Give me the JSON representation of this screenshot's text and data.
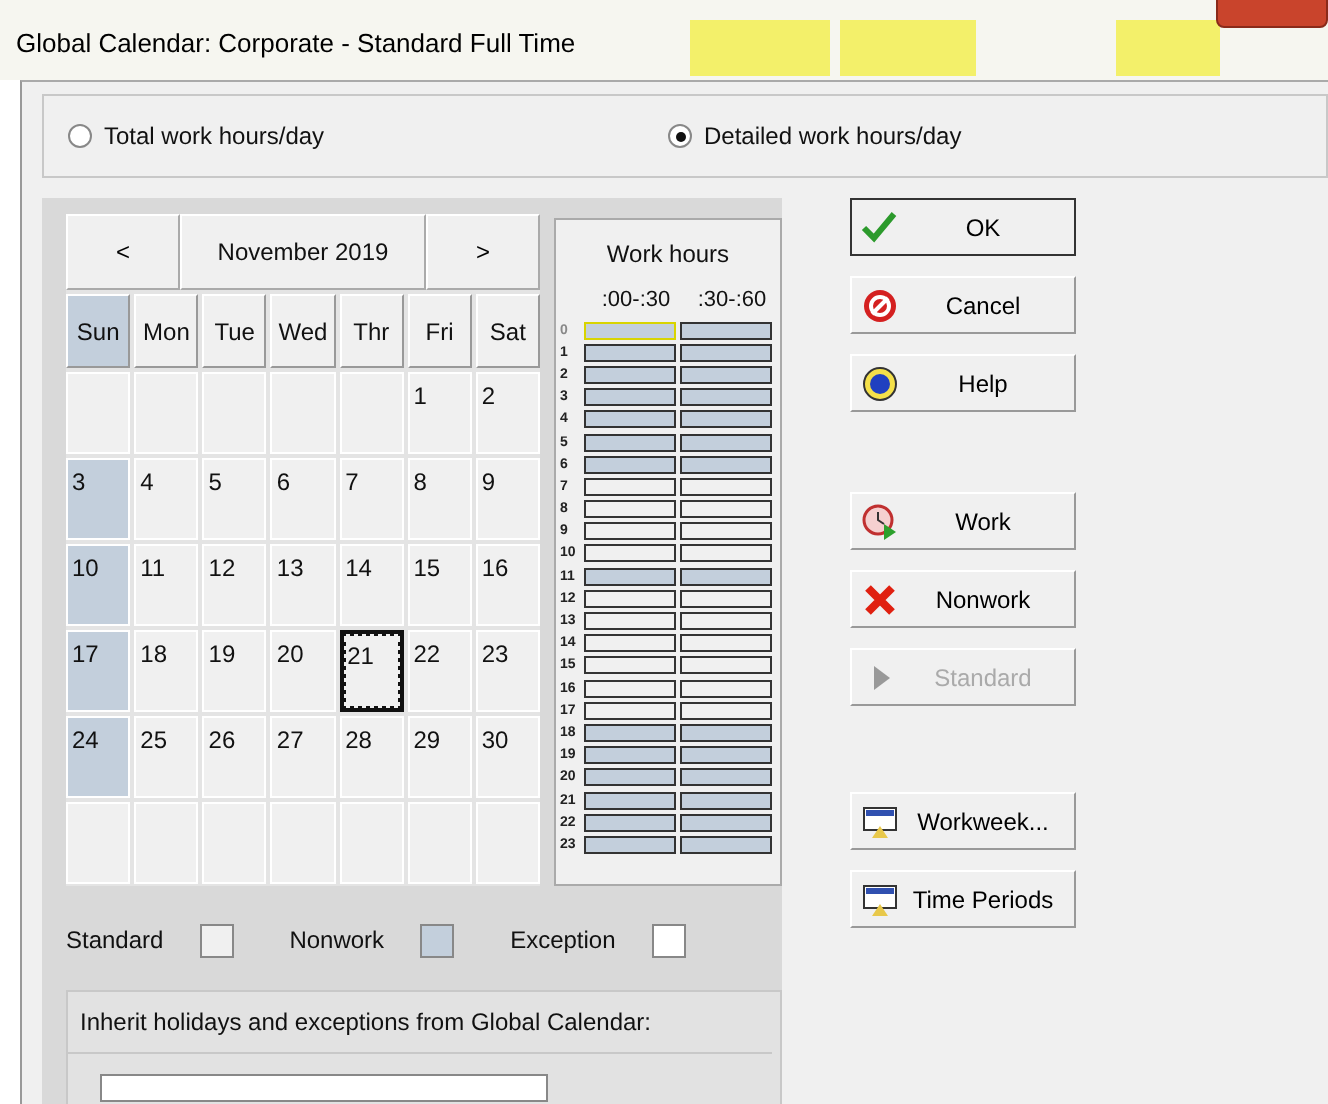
{
  "window": {
    "title": "Global Calendar: Corporate - Standard Full Time"
  },
  "mode_options": [
    {
      "label": "Total work hours/day",
      "selected": false
    },
    {
      "label": "Detailed work hours/day",
      "selected": true
    }
  ],
  "calendar": {
    "prev": "<",
    "month": "November 2019",
    "next": ">",
    "weekdays": [
      {
        "label": "Sun",
        "nonwork": true
      },
      {
        "label": "Mon",
        "nonwork": false
      },
      {
        "label": "Tue",
        "nonwork": false
      },
      {
        "label": "Wed",
        "nonwork": false
      },
      {
        "label": "Thr",
        "nonwork": false
      },
      {
        "label": "Fri",
        "nonwork": false
      },
      {
        "label": "Sat",
        "nonwork": false
      }
    ],
    "weeks": [
      [
        {
          "nonwork": false
        },
        {
          "nonwork": false
        },
        {
          "nonwork": false
        },
        {
          "nonwork": false
        },
        {
          "nonwork": false
        },
        {
          "day": "1",
          "nonwork": false,
          "selected": false
        },
        {
          "day": "2",
          "nonwork": false,
          "selected": false
        }
      ],
      [
        {
          "day": "3",
          "nonwork": true,
          "selected": false
        },
        {
          "day": "4",
          "nonwork": false,
          "selected": false
        },
        {
          "day": "5",
          "nonwork": false,
          "selected": false
        },
        {
          "day": "6",
          "nonwork": false,
          "selected": false
        },
        {
          "day": "7",
          "nonwork": false,
          "selected": false
        },
        {
          "day": "8",
          "nonwork": false,
          "selected": false
        },
        {
          "day": "9",
          "nonwork": false,
          "selected": false
        }
      ],
      [
        {
          "day": "10",
          "nonwork": true,
          "selected": false
        },
        {
          "day": "11",
          "nonwork": false,
          "selected": false
        },
        {
          "day": "12",
          "nonwork": false,
          "selected": false
        },
        {
          "day": "13",
          "nonwork": false,
          "selected": false
        },
        {
          "day": "14",
          "nonwork": false,
          "selected": false
        },
        {
          "day": "15",
          "nonwork": false,
          "selected": false
        },
        {
          "day": "16",
          "nonwork": false,
          "selected": false
        }
      ],
      [
        {
          "day": "17",
          "nonwork": true,
          "selected": false
        },
        {
          "day": "18",
          "nonwork": false,
          "selected": false
        },
        {
          "day": "19",
          "nonwork": false,
          "selected": false
        },
        {
          "day": "20",
          "nonwork": false,
          "selected": false
        },
        {
          "day": "21",
          "nonwork": false,
          "selected": true
        },
        {
          "day": "22",
          "nonwork": false,
          "selected": false
        },
        {
          "day": "23",
          "nonwork": false,
          "selected": false
        }
      ],
      [
        {
          "day": "24",
          "nonwork": true,
          "selected": false
        },
        {
          "day": "25",
          "nonwork": false,
          "selected": false
        },
        {
          "day": "26",
          "nonwork": false,
          "selected": false
        },
        {
          "day": "27",
          "nonwork": false,
          "selected": false
        },
        {
          "day": "28",
          "nonwork": false,
          "selected": false
        },
        {
          "day": "29",
          "nonwork": false,
          "selected": false
        },
        {
          "day": "30",
          "nonwork": false,
          "selected": false
        }
      ],
      [
        {
          "nonwork": false
        },
        {
          "nonwork": false
        },
        {
          "nonwork": false
        },
        {
          "nonwork": false
        },
        {
          "nonwork": false
        },
        {
          "nonwork": false
        },
        {
          "nonwork": false
        }
      ]
    ]
  },
  "work_hours": {
    "title": "Work hours",
    "columns": [
      ":00-:30",
      ":30-:60"
    ],
    "hours": [
      {
        "hour": "0",
        "slots": [
          {
            "nonwork": true,
            "selected": true
          },
          {
            "nonwork": true,
            "selected": false
          }
        ]
      },
      {
        "hour": "1",
        "slots": [
          {
            "nonwork": true,
            "selected": false
          },
          {
            "nonwork": true,
            "selected": false
          }
        ]
      },
      {
        "hour": "2",
        "slots": [
          {
            "nonwork": true,
            "selected": false
          },
          {
            "nonwork": true,
            "selected": false
          }
        ]
      },
      {
        "hour": "3",
        "slots": [
          {
            "nonwork": true,
            "selected": false
          },
          {
            "nonwork": true,
            "selected": false
          }
        ]
      },
      {
        "hour": "4",
        "slots": [
          {
            "nonwork": true,
            "selected": false
          },
          {
            "nonwork": true,
            "selected": false
          }
        ]
      },
      {
        "hour": "5",
        "slots": [
          {
            "nonwork": true,
            "selected": false
          },
          {
            "nonwork": true,
            "selected": false
          }
        ]
      },
      {
        "hour": "6",
        "slots": [
          {
            "nonwork": true,
            "selected": false
          },
          {
            "nonwork": true,
            "selected": false
          }
        ]
      },
      {
        "hour": "7",
        "slots": [
          {
            "nonwork": false,
            "selected": false
          },
          {
            "nonwork": false,
            "selected": false
          }
        ]
      },
      {
        "hour": "8",
        "slots": [
          {
            "nonwork": false,
            "selected": false
          },
          {
            "nonwork": false,
            "selected": false
          }
        ]
      },
      {
        "hour": "9",
        "slots": [
          {
            "nonwork": false,
            "selected": false
          },
          {
            "nonwork": false,
            "selected": false
          }
        ]
      },
      {
        "hour": "10",
        "slots": [
          {
            "nonwork": false,
            "selected": false
          },
          {
            "nonwork": false,
            "selected": false
          }
        ]
      },
      {
        "hour": "11",
        "slots": [
          {
            "nonwork": true,
            "selected": false
          },
          {
            "nonwork": true,
            "selected": false
          }
        ]
      },
      {
        "hour": "12",
        "slots": [
          {
            "nonwork": false,
            "selected": false
          },
          {
            "nonwork": false,
            "selected": false
          }
        ]
      },
      {
        "hour": "13",
        "slots": [
          {
            "nonwork": false,
            "selected": false
          },
          {
            "nonwork": false,
            "selected": false
          }
        ]
      },
      {
        "hour": "14",
        "slots": [
          {
            "nonwork": false,
            "selected": false
          },
          {
            "nonwork": false,
            "selected": false
          }
        ]
      },
      {
        "hour": "15",
        "slots": [
          {
            "nonwork": false,
            "selected": false
          },
          {
            "nonwork": false,
            "selected": false
          }
        ]
      },
      {
        "hour": "16",
        "slots": [
          {
            "nonwork": false,
            "selected": false
          },
          {
            "nonwork": false,
            "selected": false
          }
        ]
      },
      {
        "hour": "17",
        "slots": [
          {
            "nonwork": false,
            "selected": false
          },
          {
            "nonwork": false,
            "selected": false
          }
        ]
      },
      {
        "hour": "18",
        "slots": [
          {
            "nonwork": true,
            "selected": false
          },
          {
            "nonwork": true,
            "selected": false
          }
        ]
      },
      {
        "hour": "19",
        "slots": [
          {
            "nonwork": true,
            "selected": false
          },
          {
            "nonwork": true,
            "selected": false
          }
        ]
      },
      {
        "hour": "20",
        "slots": [
          {
            "nonwork": true,
            "selected": false
          },
          {
            "nonwork": true,
            "selected": false
          }
        ]
      },
      {
        "hour": "21",
        "slots": [
          {
            "nonwork": true,
            "selected": false
          },
          {
            "nonwork": true,
            "selected": false
          }
        ]
      },
      {
        "hour": "22",
        "slots": [
          {
            "nonwork": true,
            "selected": false
          },
          {
            "nonwork": true,
            "selected": false
          }
        ]
      },
      {
        "hour": "23",
        "slots": [
          {
            "nonwork": true,
            "selected": false
          },
          {
            "nonwork": true,
            "selected": false
          }
        ]
      }
    ]
  },
  "legend": [
    {
      "label": "Standard",
      "kind": "standard"
    },
    {
      "label": "Nonwork",
      "kind": "nonwork"
    },
    {
      "label": "Exception",
      "kind": "exception"
    }
  ],
  "inherit": {
    "label": "Inherit holidays and exceptions from Global Calendar:"
  },
  "buttons": [
    {
      "label": "OK",
      "kind": "ok",
      "disabled": false
    },
    {
      "label": "Cancel",
      "kind": "cancel",
      "disabled": false
    },
    {
      "label": "Help",
      "kind": "help",
      "disabled": false
    },
    {
      "label": "Work",
      "kind": "work",
      "disabled": false
    },
    {
      "label": "Nonwork",
      "kind": "nonwork",
      "disabled": false
    },
    {
      "label": "Standard",
      "kind": "standard",
      "disabled": true
    },
    {
      "label": "Workweek...",
      "kind": "period",
      "disabled": false
    },
    {
      "label": "Time Periods",
      "kind": "period",
      "disabled": false
    }
  ]
}
